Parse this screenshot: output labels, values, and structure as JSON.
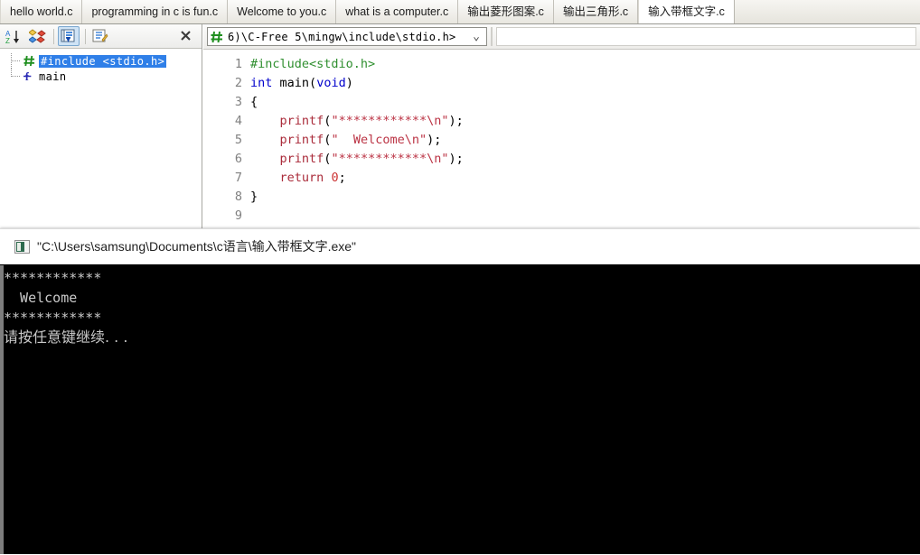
{
  "window": {
    "app_name": "C-Free 5",
    "tabs": [
      {
        "label": "hello world.c",
        "active": false
      },
      {
        "label": "programming in c is fun.c",
        "active": false
      },
      {
        "label": "Welcome to you.c",
        "active": false
      },
      {
        "label": "what is a computer.c",
        "active": false
      },
      {
        "label": "输出菱形图案.c",
        "active": false
      },
      {
        "label": "输出三角形.c",
        "active": false
      },
      {
        "label": "输入带框文字.c",
        "active": true
      }
    ]
  },
  "sidebar": {
    "toolbar": [
      {
        "name": "sort-alphabetical-icon",
        "tip": "Sort A-Z"
      },
      {
        "name": "group-shapes-icon",
        "tip": "Group by type"
      },
      {
        "name": "show-outline-icon",
        "tip": "Show outline",
        "pressed": true
      },
      {
        "name": "edit-list-icon",
        "tip": "Edit list"
      }
    ],
    "close_label": "✕",
    "tree": [
      {
        "label": "#include <stdio.h>",
        "icon": "hash-icon",
        "selected": true
      },
      {
        "label": "main",
        "icon": "function-icon",
        "selected": false
      }
    ]
  },
  "editor": {
    "scope_combo": {
      "value": "6)\\C-Free 5\\mingw\\include\\stdio.h>",
      "icon": "hash-icon",
      "chevron": "⌄"
    },
    "lines": [
      {
        "n": "1",
        "tokens": [
          {
            "t": "#include<stdio.h>",
            "c": "k-pre"
          }
        ]
      },
      {
        "n": "2",
        "tokens": [
          {
            "t": "int",
            "c": "k-key"
          },
          {
            "t": " ",
            "c": "k-pun"
          },
          {
            "t": "main",
            "c": "k-fn"
          },
          {
            "t": "(",
            "c": "k-pun"
          },
          {
            "t": "void",
            "c": "k-key"
          },
          {
            "t": ")",
            "c": "k-pun"
          }
        ]
      },
      {
        "n": "3",
        "tokens": [
          {
            "t": "{",
            "c": "k-pun"
          }
        ]
      },
      {
        "n": "4",
        "tokens": [
          {
            "t": "    ",
            "c": "k-pun"
          },
          {
            "t": "printf",
            "c": "k-id"
          },
          {
            "t": "(",
            "c": "k-pun"
          },
          {
            "t": "\"************\\n\"",
            "c": "k-str"
          },
          {
            "t": ");",
            "c": "k-pun"
          }
        ]
      },
      {
        "n": "5",
        "tokens": [
          {
            "t": "    ",
            "c": "k-pun"
          },
          {
            "t": "printf",
            "c": "k-id"
          },
          {
            "t": "(",
            "c": "k-pun"
          },
          {
            "t": "\"  Welcome\\n\"",
            "c": "k-str"
          },
          {
            "t": ");",
            "c": "k-pun"
          }
        ]
      },
      {
        "n": "6",
        "tokens": [
          {
            "t": "    ",
            "c": "k-pun"
          },
          {
            "t": "printf",
            "c": "k-id"
          },
          {
            "t": "(",
            "c": "k-pun"
          },
          {
            "t": "\"************\\n\"",
            "c": "k-str"
          },
          {
            "t": ");",
            "c": "k-pun"
          }
        ]
      },
      {
        "n": "7",
        "tokens": [
          {
            "t": "    ",
            "c": "k-pun"
          },
          {
            "t": "return",
            "c": "k-id"
          },
          {
            "t": " ",
            "c": "k-pun"
          },
          {
            "t": "0",
            "c": "k-num"
          },
          {
            "t": ";",
            "c": "k-pun"
          }
        ]
      },
      {
        "n": "8",
        "tokens": [
          {
            "t": "}",
            "c": "k-pun"
          }
        ]
      },
      {
        "n": "9",
        "tokens": []
      }
    ]
  },
  "console": {
    "icon": "console-window-icon",
    "title": "\"C:\\Users\\samsung\\Documents\\c语言\\输入带框文字.exe\"",
    "output": [
      "************",
      "  Welcome",
      "************",
      "请按任意键继续. . ."
    ]
  },
  "colors": {
    "selection_blue": "#2f7fe8",
    "preprocessor_green": "#2f8f2f",
    "keyword_blue": "#0000cc",
    "string_red": "#bb3344",
    "console_bg": "#000000",
    "console_fg": "#c9c9c9"
  }
}
